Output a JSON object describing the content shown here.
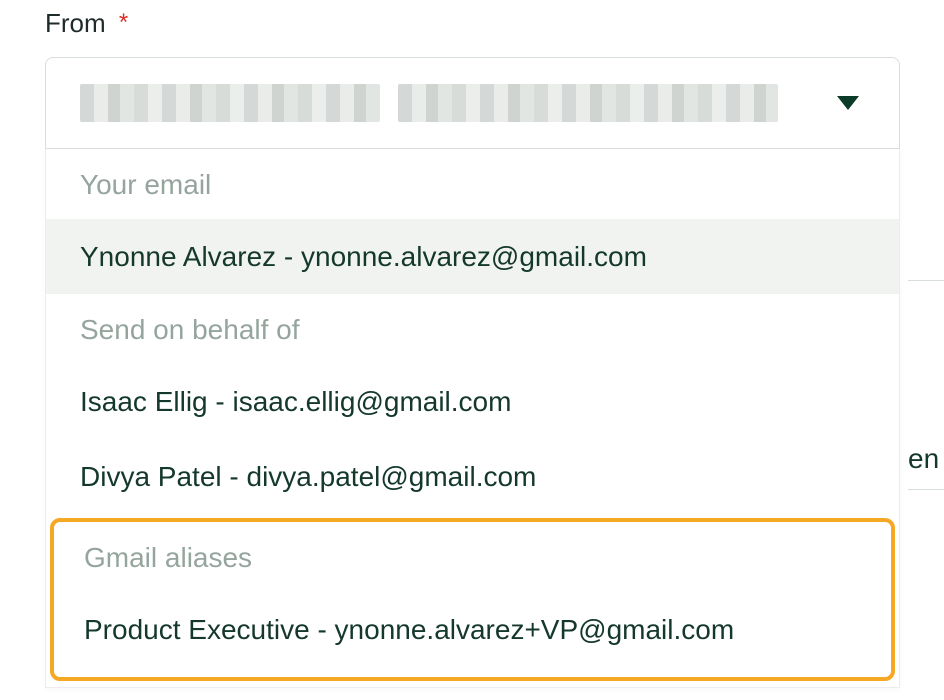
{
  "field": {
    "label": "From",
    "required_marker": "*"
  },
  "select": {
    "current_value_obscured": true
  },
  "dropdown": {
    "groups": [
      {
        "key": "your_email",
        "header": "Your email",
        "options": [
          {
            "label": "Ynonne Alvarez - ynonne.alvarez@gmail.com",
            "selected": true
          }
        ]
      },
      {
        "key": "send_on_behalf",
        "header": "Send on behalf of",
        "options": [
          {
            "label": "Isaac Ellig - isaac.ellig@gmail.com",
            "selected": false
          },
          {
            "label": "Divya Patel - divya.patel@gmail.com",
            "selected": false
          }
        ]
      },
      {
        "key": "gmail_aliases",
        "header": "Gmail aliases",
        "highlighted": true,
        "options": [
          {
            "label": "Product Executive - ynonne.alvarez+VP@gmail.com",
            "selected": false
          }
        ]
      }
    ]
  },
  "background_fragment": "en"
}
